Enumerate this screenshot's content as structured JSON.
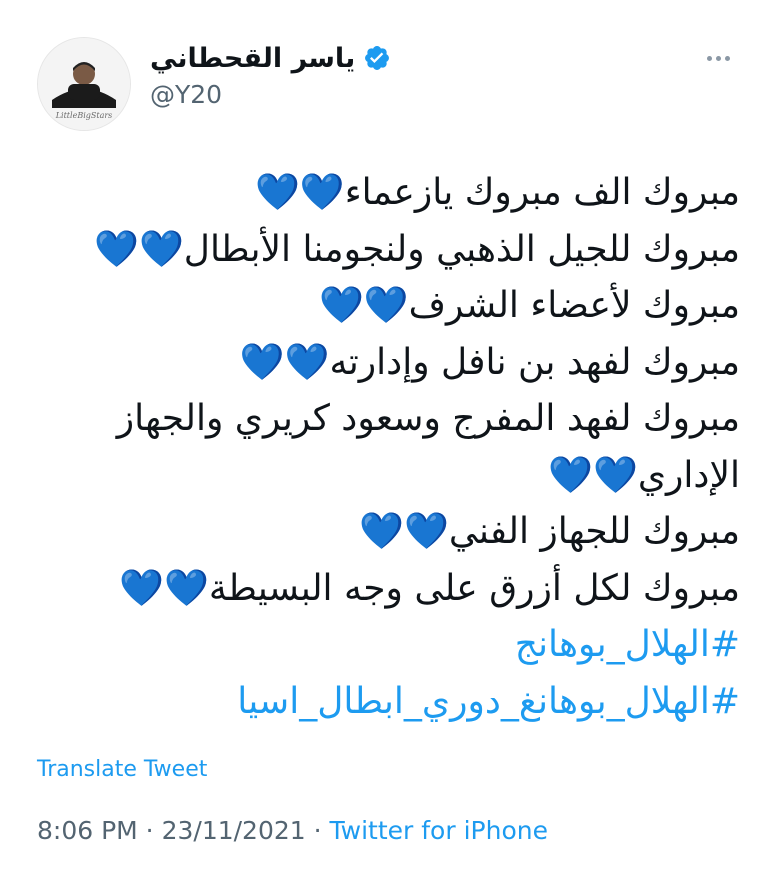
{
  "author": {
    "display_name": "ياسر القحطاني",
    "handle": "@Y20",
    "verified_icon": "verified-badge-icon",
    "avatar_caption": "LittleBigStars"
  },
  "tweet": {
    "lines": [
      "مبروك الف مبروك يازعماء💙💙",
      "مبروك للجيل الذهبي ولنجومنا الأبطال💙💙",
      "مبروك لأعضاء الشرف💙💙",
      "مبروك لفهد بن نافل وإدارته💙💙",
      "مبروك لفهد المفرج وسعود كريري والجهاز",
      "الإداري💙💙",
      "مبروك للجهاز الفني💙💙",
      "مبروك لكل أزرق على وجه البسيطة💙💙"
    ],
    "hashtags": [
      "#الهلال_بوهانج",
      "#الهلال_بوهانغ_دوري_ابطال_اسيا"
    ]
  },
  "translate_label": "Translate Tweet",
  "meta": {
    "time": "8:06 PM",
    "separator": " · ",
    "date": "23/11/2021",
    "source": "Twitter for iPhone"
  },
  "colors": {
    "accent": "#1d9bf0",
    "text": "#0f1419",
    "muted": "#536471"
  }
}
